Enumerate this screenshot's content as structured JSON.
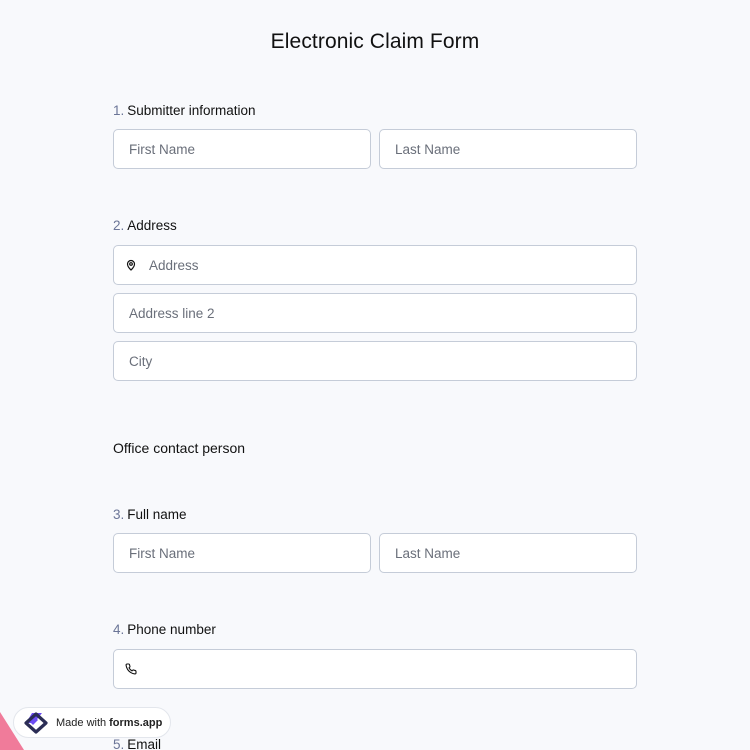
{
  "form": {
    "title": "Electronic Claim Form"
  },
  "questions": {
    "q1": {
      "number": "1.",
      "label": "Submitter information",
      "first_placeholder": "First Name",
      "last_placeholder": "Last Name"
    },
    "q2": {
      "number": "2.",
      "label": "Address",
      "address_placeholder": "Address",
      "address2_placeholder": "Address line 2",
      "city_placeholder": "City"
    },
    "section": {
      "title": "Office contact person"
    },
    "q3": {
      "number": "3.",
      "label": "Full name",
      "first_placeholder": "First Name",
      "last_placeholder": "Last Name"
    },
    "q4": {
      "number": "4.",
      "label": "Phone number",
      "phone_placeholder": ""
    },
    "q5": {
      "number": "5.",
      "label": "Email"
    }
  },
  "icons": {
    "address": "map-pin-icon",
    "phone": "phone-icon",
    "brand": "forms-app-logo"
  },
  "badge": {
    "prefix": "Made with",
    "brand": "forms.app"
  },
  "colors": {
    "background": "#f8f9fc",
    "field_border": "#c5ccd8",
    "number": "#6b7597",
    "brand_purple": "#6c4cf4",
    "brand_dark": "#2b2d55",
    "corner_pink": "#f07b9a"
  }
}
